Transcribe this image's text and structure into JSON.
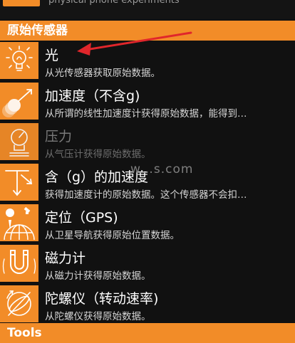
{
  "top": {
    "partial_text": "physical phone experiments"
  },
  "section_raw": {
    "header": "原始传感器"
  },
  "sensors": [
    {
      "title": "光",
      "desc": "从光传感器获取原始数据。",
      "icon": "lightbulb-icon",
      "enabled": true
    },
    {
      "title": "加速度（不含g)",
      "desc": "从所谓的线性加速度计获得原始数据，能得到…",
      "icon": "accelerometer-icon",
      "enabled": true
    },
    {
      "title": "压力",
      "desc": "从气压计获得原始数据。",
      "icon": "barometer-icon",
      "enabled": false
    },
    {
      "title": "含（g）的加速度",
      "desc": "获得加速度计的原始数据。这个传感器不会扣…",
      "icon": "gravity-acceleration-icon",
      "enabled": true
    },
    {
      "title": "定位（GPS)",
      "desc": "从卫星导航获得原始位置数据。",
      "icon": "satellite-globe-icon",
      "enabled": true
    },
    {
      "title": "磁力计",
      "desc": "从磁力计获得原始数据。",
      "icon": "magnet-icon",
      "enabled": true
    },
    {
      "title": "陀螺仪（转动速率)",
      "desc": "从陀螺仪获得原始数据。",
      "icon": "gyroscope-icon",
      "enabled": true
    }
  ],
  "section_tools": {
    "header": "Tools"
  },
  "watermark": "w…s.com",
  "colors": {
    "accent": "#f28c28",
    "background": "#111111",
    "arrow": "#e0262b"
  }
}
